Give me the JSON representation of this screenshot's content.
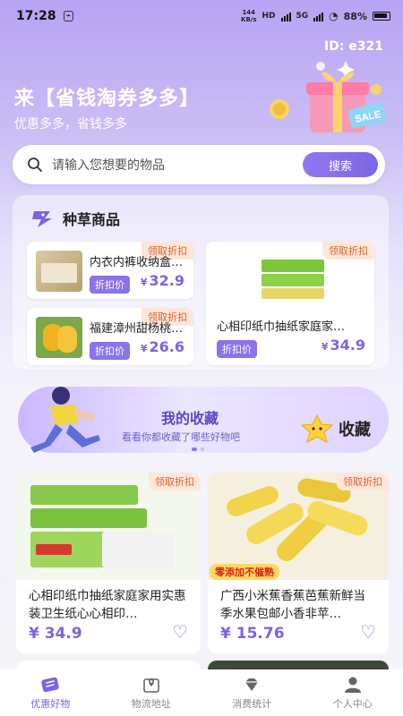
{
  "status_bar": {
    "time": "17:28",
    "speed_value": "144",
    "speed_unit": "KB/s",
    "network_a": "HD",
    "network_b": "5G",
    "battery": "88%"
  },
  "header": {
    "user_id": "ID: e321",
    "headline": "来【省钱淘券多多】",
    "subline": "优惠多多，省钱多多",
    "sale_text": "SALE"
  },
  "search": {
    "placeholder": "请输入您想要的物品",
    "button": "搜索"
  },
  "recommend": {
    "title": "种草商品",
    "badge": "领取折扣",
    "discount_tag": "折扣价",
    "currency": "¥",
    "items": [
      {
        "title": "内衣内裤收纳盒…",
        "price": "32.9"
      },
      {
        "title": "福建漳州甜杨桃…",
        "price": "26.6"
      },
      {
        "title": "心相印纸巾抽纸家庭家…",
        "price": "34.9"
      }
    ]
  },
  "favorites": {
    "title": "我的收藏",
    "subtitle": "看看你都收藏了哪些好物吧",
    "badge": "收藏"
  },
  "products": [
    {
      "title": "心相印纸巾抽纸家庭家用实惠装卫生纸心心相印…",
      "badge": "领取折扣",
      "price": "¥ 34.9"
    },
    {
      "title": "广西小米蕉香蕉芭蕉新鲜当季水果包邮小香非苹…",
      "badge": "领取折扣",
      "banner": "零添加不催熟",
      "price": "¥ 15.76"
    }
  ],
  "nav": {
    "items": [
      {
        "label": "优惠好物"
      },
      {
        "label": "物流地址"
      },
      {
        "label": "消费统计"
      },
      {
        "label": "个人中心"
      }
    ]
  },
  "colors": {
    "accent": "#7a63e4",
    "badge_bg": "#fde6da",
    "badge_text": "#e0622c"
  }
}
